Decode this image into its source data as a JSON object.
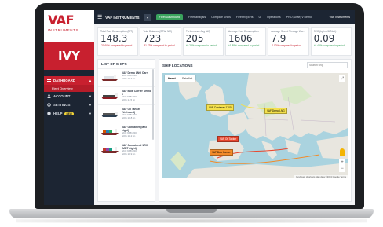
{
  "brand": {
    "logo": "VAF",
    "logo_sub": "INSTRUMENTS",
    "client": "IVY"
  },
  "nav": [
    {
      "label": "DASHBOARD",
      "active": true
    },
    {
      "label": "Fleet Overview",
      "sub": true
    },
    {
      "label": "ACCOUNT"
    },
    {
      "label": "SETTINGS"
    },
    {
      "label": "HELP",
      "badge": "NEW"
    }
  ],
  "header": {
    "title": "VAF INSTRUMENTS",
    "tabs": [
      "Fleet Dashboard",
      "Fleet analysis",
      "Compare Ships",
      "Fleet Reports",
      "UI",
      "Operations",
      "PRO (Draft) v Demo"
    ],
    "active_tab": "Fleet Dashboard",
    "vessel": "VAF Instruments"
  },
  "kpis": [
    {
      "label": "Total Fuel Consumption (MT)",
      "value": "148.3",
      "delta": "-20.60% compared to period",
      "trend": "down"
    },
    {
      "label": "Total Distance (STW, NM)",
      "value": "723",
      "delta": "-81.73% compared to period",
      "trend": "down"
    },
    {
      "label": "Performance Avg (All)",
      "value": "205",
      "delta": "+9.22% compared to period",
      "trend": "up"
    },
    {
      "label": "Average Fuel Consumption",
      "value": "1606",
      "delta": "+1.88% compared to period",
      "trend": "up"
    },
    {
      "label": "Average Speed Through Wa...",
      "value": "7.9",
      "delta": "-0.02% compared to period",
      "trend": "down"
    },
    {
      "label": "SEC (kg/nm/MTdwt)",
      "value": "0.09",
      "delta": "+8.48% compared to period",
      "trend": "up"
    }
  ],
  "ships_panel": {
    "title": "LIST OF SHIPS",
    "ships": [
      {
        "name": "VAF Demo LNG Carr",
        "l1": "SKO 9281220",
        "l2": "SOG 12.3 kn"
      },
      {
        "name": "VAF Bulk Carrier Demo 1",
        "l1": "SKO 9281220",
        "l2": "SOG 11.5 kn"
      },
      {
        "name": "VAF Oil Tanker (Verhuurd)",
        "l1": "SKO 9281220",
        "l2": "SOG 10.8 kn"
      },
      {
        "name": "VAF Container (MBT Light)",
        "l1": "SKO 9281220",
        "l2": "SOG 14.2 kn"
      },
      {
        "name": "VAF Containerd 1700 (MBT Light)",
        "l1": "SKO 9281220",
        "l2": "SOG 13.9 kn"
      }
    ]
  },
  "map_panel": {
    "title": "SHIP LOCATIONS",
    "search_placeholder": "Search ship",
    "toggle": [
      "Kaart",
      "Satelliet"
    ],
    "attribution": "Keyboard shortcuts  Map data ©2024 Google  Terms",
    "routes": [
      {
        "label": "VAF Container 1700",
        "color": "#f4e04d"
      },
      {
        "label": "VAF Oil Tanker",
        "color": "#e8472e"
      },
      {
        "label": "VAF Bulk Carrier",
        "color": "#f28b2a"
      },
      {
        "label": "VAF Demo LNG",
        "color": "#f4e04d"
      }
    ]
  }
}
